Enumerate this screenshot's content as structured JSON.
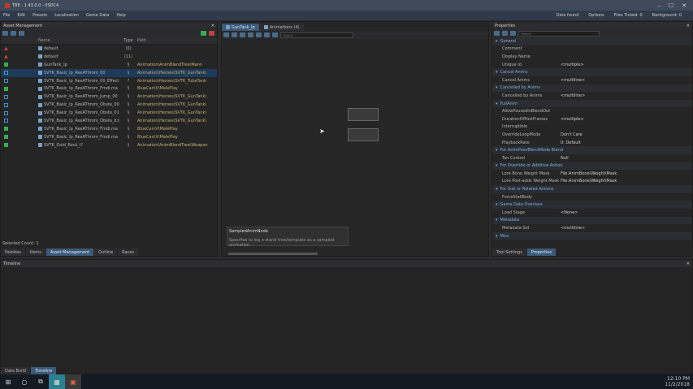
{
  "window": {
    "title": "TBE - 1.43.0.0 - 0SDC4",
    "controls": [
      "–",
      "☐",
      "✕"
    ]
  },
  "menu": [
    "File",
    "Edit",
    "Presets",
    "Localization",
    "Game Data",
    "Help"
  ],
  "status_items": [
    "Data found",
    "Options",
    "Files Ticked: 0",
    "Background: 0"
  ],
  "asset_panel": {
    "title": "Asset Management",
    "columns": {
      "name": "Name",
      "type": "Type",
      "path": "Path"
    },
    "rows": [
      {
        "name": "default",
        "type": "(0)",
        "path": "",
        "icon": "red"
      },
      {
        "name": "default",
        "type": "(11)",
        "path": "",
        "icon": "red"
      },
      {
        "name": "GunTank_Ip",
        "type": "§",
        "path": "Animation\\AnimBlendTree\\Mann",
        "icon": "green",
        "sel": false
      },
      {
        "name": "SVTK_Basic_Ip_RexAThrom_00",
        "type": "§",
        "path": "Animation\\Heroes\\SVTK_GunTank\\",
        "icon": "blue",
        "sel": true
      },
      {
        "name": "SVTK_Basic_Ip_RexAThrom_00_Effect",
        "type": "?",
        "path": "Animation\\Heroes\\SVTK_TubeTank",
        "icon": "blue",
        "sel": false
      },
      {
        "name": "SVTK_Basic_Ip_RexAThrom_Fmdi.ma",
        "type": "§",
        "path": "BlueCan\\V\\MalePlay",
        "icon": "green",
        "sel": false
      },
      {
        "name": "SVTK_Basic_Ip_RexAThrom_Jump_00",
        "type": "§",
        "path": "Animation\\Heroes\\SVTK_GunTank\\",
        "icon": "blue",
        "sel": false
      },
      {
        "name": "SVTK_Basic_Ip_RexAThrom_Obste_00",
        "type": "§",
        "path": "Animation\\Heroes\\SVTK_GunTank\\",
        "icon": "blue",
        "sel": false
      },
      {
        "name": "SVTK_Basic_Ip_RexAThrom_Obste_01",
        "type": "§",
        "path": "Animation\\Heroes\\SVTK_GunTank\\",
        "icon": "blue",
        "sel": false
      },
      {
        "name": "SVTK_Basic_Ip_RexAThrom_Obste_d.tr",
        "type": "§",
        "path": "Animation\\Heroes\\SVTK_GunTank\\",
        "icon": "blue",
        "sel": false
      },
      {
        "name": "SVTK_Basic_Ip_RexAThrom_Fmdi.ma",
        "type": "§",
        "path": "BlueCan\\V\\MalePlay",
        "icon": "green",
        "sel": false
      },
      {
        "name": "SVTK_Basic_Ip_RexAThrom_Fmdi.ma",
        "type": "§",
        "path": "BlueCan\\V\\MalePlay",
        "icon": "green",
        "sel": false
      },
      {
        "name": "SVTK_Gold_Rock_I?",
        "type": "§",
        "path": "Animation\\AnimBlendTree\\Weapon",
        "icon": "green",
        "sel": false
      }
    ],
    "selected_count": "Selected Count: 1",
    "tabs": [
      "Palettes",
      "Items",
      "Asset Management",
      "Outline",
      "Races"
    ]
  },
  "editor": {
    "tabs": [
      "GunTank_Ip",
      "Animations (4)"
    ],
    "search_placeholder": "Search",
    "tooltip_title": "SampledAnimNode",
    "tooltip_text": "Specifies to log a stand tree/template as a sampled animation."
  },
  "properties": {
    "title": "Properties",
    "search_placeholder": "Search",
    "sections": [
      {
        "name": "General",
        "rows": [
          [
            "Comment",
            ""
          ],
          [
            "Display Name",
            ""
          ],
          [
            "Unique Id",
            "<multiple>"
          ]
        ]
      },
      {
        "name": "Cancel Anims",
        "rows": [
          [
            "Cancel Anims",
            "<multiline>"
          ]
        ]
      },
      {
        "name": "Cancelled by Anims",
        "rows": [
          [
            "Cancelled by Anims",
            "<multiline>"
          ]
        ]
      },
      {
        "name": "FullAnim",
        "rows": [
          [
            "AllowPausedInBlendOut",
            ""
          ],
          [
            "DurationOfPostFrames",
            "<multiple>"
          ],
          [
            "Interruptible",
            ""
          ],
          [
            "OverrideLoopMode",
            "Don't Care"
          ],
          [
            "PlaybackRate",
            "0: Default"
          ]
        ]
      },
      {
        "name": "For AnimPoseBlendMode Blend",
        "rows": [
          [
            "Tan Control",
            "Null"
          ]
        ]
      },
      {
        "name": "For Override or Additive Action",
        "rows": [
          [
            "Lore Bone Weight Mask",
            "File:AnimBone\\Weight\\Mask"
          ],
          [
            "Lore Post-adds Weight Mask",
            "File:AnimBone\\Weight\\Mask"
          ]
        ]
      },
      {
        "name": "For Sub or Related Actions",
        "rows": [
          [
            "ForceStallBody",
            ""
          ]
        ]
      },
      {
        "name": "Game Data Overlays",
        "rows": [
          [
            "Load Stage",
            "<None>"
          ]
        ]
      },
      {
        "name": "Metadata",
        "rows": [
          [
            "Metadata Set",
            "<multiline>"
          ]
        ]
      },
      {
        "name": "Misc",
        "rows": []
      }
    ],
    "tabs": [
      "Tool Settings",
      "Properties"
    ]
  },
  "timeline": {
    "title": "Timeline",
    "tabs": [
      "Data Build",
      "Timeline"
    ]
  },
  "taskbar": {
    "time": "12:10 PM",
    "date": "11/2/2018"
  },
  "colors": {
    "accent": "#3a5a7a",
    "selected": "#1e3a5a",
    "titlebar": "#3f4a5a"
  }
}
